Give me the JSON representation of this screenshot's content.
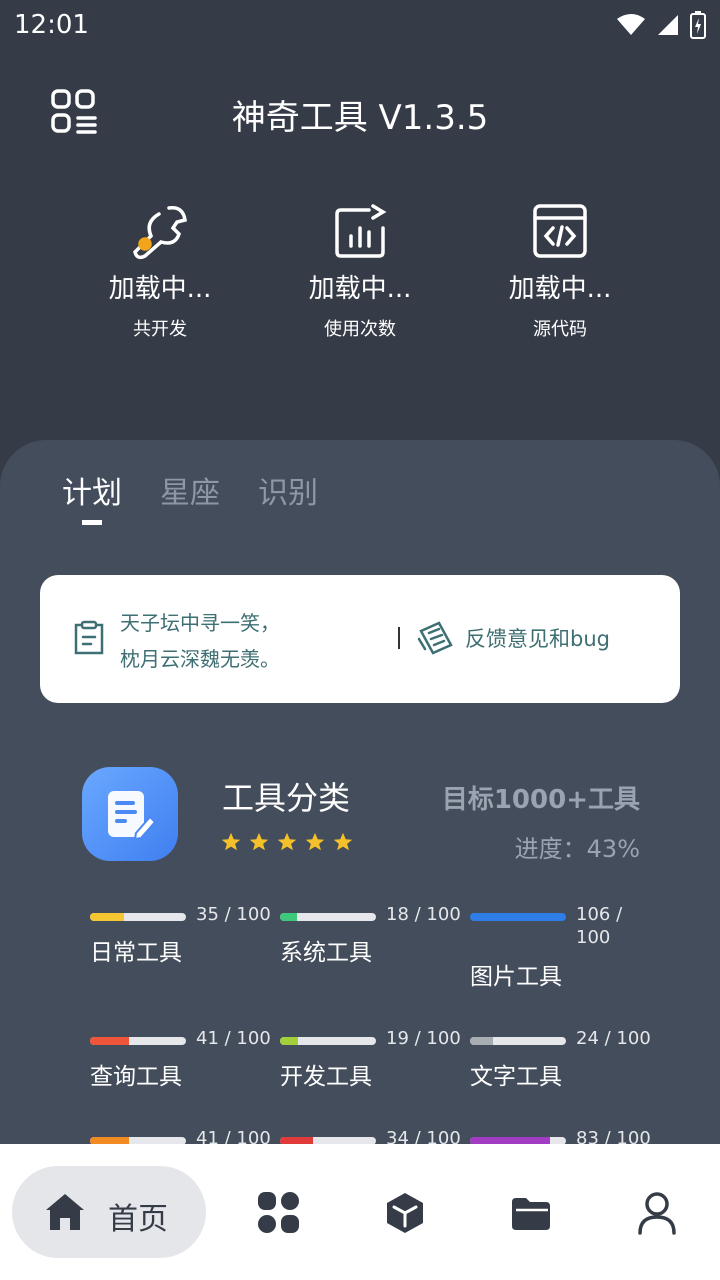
{
  "status_bar": {
    "time": "12:01"
  },
  "header": {
    "title": "神奇工具 V1.3.5"
  },
  "stats": [
    {
      "value": "加载中...",
      "label": "共开发",
      "icon": "wrench-icon"
    },
    {
      "value": "加载中...",
      "label": "使用次数",
      "icon": "chart-icon"
    },
    {
      "value": "加载中...",
      "label": "源代码",
      "icon": "code-window-icon"
    }
  ],
  "tabs": [
    {
      "label": "计划",
      "active": true
    },
    {
      "label": "星座",
      "active": false
    },
    {
      "label": "识别",
      "active": false
    }
  ],
  "notice": {
    "line1": "天子坛中寻一笑，",
    "line2": "枕月云深魏无羡。",
    "separator": "|",
    "feedback": "反馈意见和bug"
  },
  "category": {
    "title": "工具分类",
    "rating": 5,
    "goal": "目标1000+工具",
    "progress": "进度：43%"
  },
  "tools": [
    {
      "name": "日常工具",
      "count": "35 / 100",
      "fraction": 0.35,
      "color": "#f6c532"
    },
    {
      "name": "系统工具",
      "count": "18 / 100",
      "fraction": 0.18,
      "color": "#3ec87c"
    },
    {
      "name": "图片工具",
      "count": "106 / 100",
      "fraction": 1.0,
      "color": "#2f7ee8"
    },
    {
      "name": "查询工具",
      "count": "41 / 100",
      "fraction": 0.41,
      "color": "#f0553a"
    },
    {
      "name": "开发工具",
      "count": "19 / 100",
      "fraction": 0.19,
      "color": "#a3cf3a"
    },
    {
      "name": "文字工具",
      "count": "24 / 100",
      "fraction": 0.24,
      "color": "#a8acb3"
    },
    {
      "name": "",
      "count": "41 / 100",
      "fraction": 0.41,
      "color": "#f28a22"
    },
    {
      "name": "",
      "count": "34 / 100",
      "fraction": 0.34,
      "color": "#e03a3a"
    },
    {
      "name": "",
      "count": "83 / 100",
      "fraction": 0.83,
      "color": "#a23cc2"
    }
  ],
  "bottom_nav": {
    "home_label": "首页"
  }
}
